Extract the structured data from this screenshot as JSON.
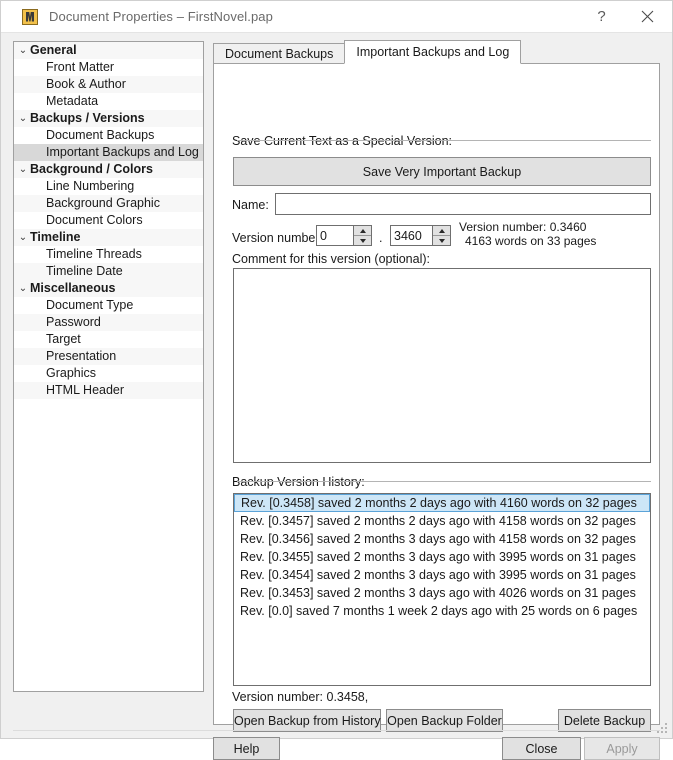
{
  "window": {
    "title": "Document Properties – FirstNovel.pap",
    "icon": "papyrus-app-icon",
    "help_label": "?",
    "close_label": "✕"
  },
  "sidebar": {
    "items": [
      {
        "label": "General",
        "type": "group",
        "expanded": true,
        "chevron": "⌄",
        "selected": false,
        "alt": true
      },
      {
        "label": "Front Matter",
        "type": "child",
        "selected": false,
        "alt": false
      },
      {
        "label": "Book & Author",
        "type": "child",
        "selected": false,
        "alt": true
      },
      {
        "label": "Metadata",
        "type": "child",
        "selected": false,
        "alt": false
      },
      {
        "label": "Backups / Versions",
        "type": "group",
        "expanded": true,
        "chevron": "⌄",
        "selected": false,
        "alt": true
      },
      {
        "label": "Document Backups",
        "type": "child",
        "selected": false,
        "alt": false
      },
      {
        "label": "Important Backups and Log",
        "type": "child",
        "selected": true,
        "alt": false
      },
      {
        "label": "Background / Colors",
        "type": "group",
        "expanded": true,
        "chevron": "⌄",
        "selected": false,
        "alt": true
      },
      {
        "label": "Line Numbering",
        "type": "child",
        "selected": false,
        "alt": false
      },
      {
        "label": "Background Graphic",
        "type": "child",
        "selected": false,
        "alt": true
      },
      {
        "label": "Document Colors",
        "type": "child",
        "selected": false,
        "alt": false
      },
      {
        "label": "Timeline",
        "type": "group",
        "expanded": true,
        "chevron": "⌄",
        "selected": false,
        "alt": true
      },
      {
        "label": "Timeline Threads",
        "type": "child",
        "selected": false,
        "alt": false
      },
      {
        "label": "Timeline Date",
        "type": "child",
        "selected": false,
        "alt": true
      },
      {
        "label": "Miscellaneous",
        "type": "group",
        "expanded": true,
        "chevron": "⌄",
        "selected": false,
        "alt": true
      },
      {
        "label": "Document Type",
        "type": "child",
        "selected": false,
        "alt": false
      },
      {
        "label": "Password",
        "type": "child",
        "selected": false,
        "alt": true
      },
      {
        "label": "Target",
        "type": "child",
        "selected": false,
        "alt": false
      },
      {
        "label": "Presentation",
        "type": "child",
        "selected": false,
        "alt": true
      },
      {
        "label": "Graphics",
        "type": "child",
        "selected": false,
        "alt": false
      },
      {
        "label": "HTML Header",
        "type": "child",
        "selected": false,
        "alt": true
      }
    ]
  },
  "tabs": [
    {
      "label": "Document Backups",
      "active": false
    },
    {
      "label": "Important Backups and Log",
      "active": true
    }
  ],
  "panel": {
    "save_group_label": "Save Current Text as a Special Version:",
    "save_button_label": "Save Very Important Backup",
    "name_label": "Name:",
    "name_value": "",
    "version_label": "Version number:",
    "version_major": "0",
    "version_separator": ".",
    "version_minor": "3460",
    "version_info_line1": "Version number: 0.3460",
    "version_info_line2": "4163 words on 33 pages",
    "comment_label": "Comment for this version (optional):",
    "comment_value": "",
    "history_group_label": "Backup Version History:",
    "history_rows": [
      {
        "text": "Rev. [0.3458]  saved 2 months 2 days ago with 4160 words on 32 pages",
        "selected": true
      },
      {
        "text": "Rev. [0.3457]  saved 2 months 2 days ago with 4158 words on 32 pages",
        "selected": false
      },
      {
        "text": "Rev. [0.3456]  saved 2 months 3 days ago with 4158 words on 32 pages",
        "selected": false
      },
      {
        "text": "Rev. [0.3455]  saved 2 months 3 days ago with 3995 words on 31 pages",
        "selected": false
      },
      {
        "text": "Rev. [0.3454]  saved 2 months 3 days ago with 3995 words on 31 pages",
        "selected": false
      },
      {
        "text": "Rev. [0.3453]  saved 2 months 3 days ago with 4026 words on 31 pages",
        "selected": false
      },
      {
        "text": "Rev. [0.0]  saved 7 months 1 week 2 days ago with 25 words on 6 pages",
        "selected": false
      }
    ],
    "selected_version_text": "Version number: 0.3458,",
    "open_from_history_label": "Open Backup from History",
    "open_folder_label": "Open Backup Folder",
    "delete_backup_label": "Delete Backup"
  },
  "footer": {
    "help_label": "Help",
    "close_label": "Close",
    "apply_label": "Apply",
    "apply_disabled": true
  },
  "colors": {
    "selection_blue": "#cde6f7",
    "selection_border": "#5ba3d8",
    "sidebar_selected": "#d8d8d8",
    "dialog_face": "#f0f0f0"
  }
}
